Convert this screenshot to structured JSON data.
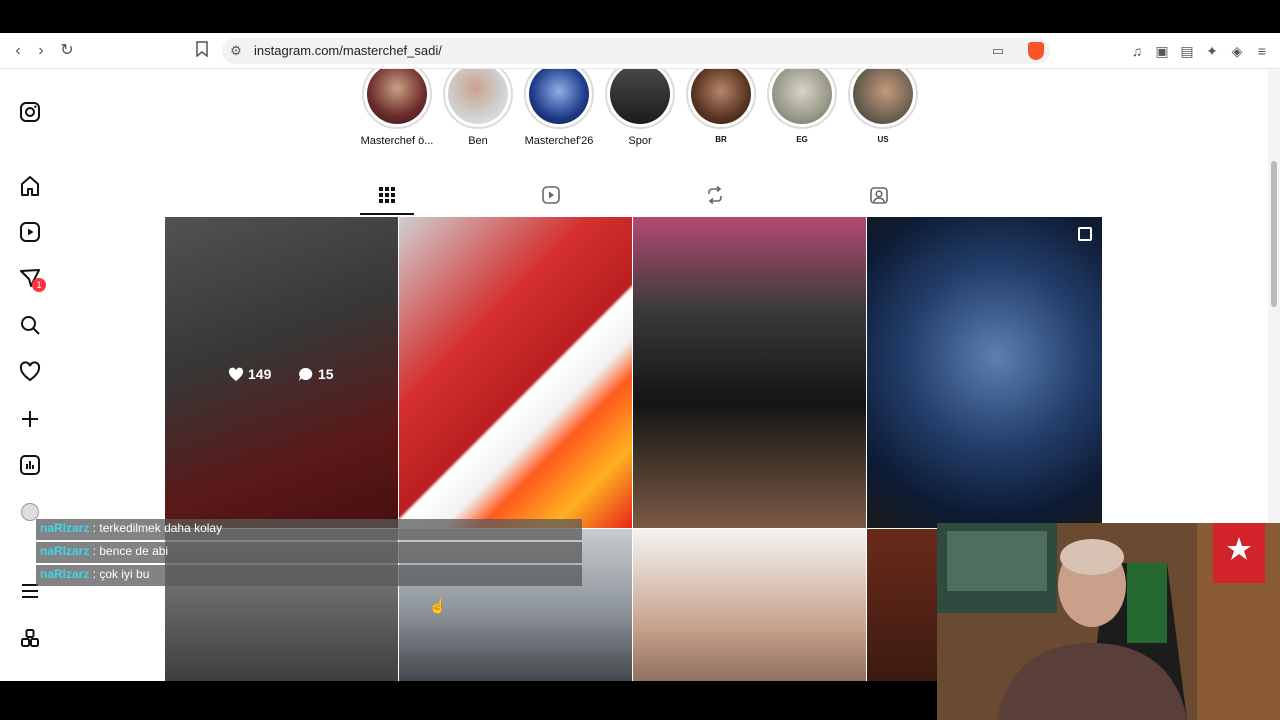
{
  "browser": {
    "url": "instagram.com/masterchef_sadi/"
  },
  "sidebar": {
    "notification_count": "1"
  },
  "highlights": [
    {
      "label": "Masterchef ö...",
      "small": false,
      "color": "#6b2b2b"
    },
    {
      "label": "Ben",
      "small": false,
      "color": "#cfcfcf"
    },
    {
      "label": "Masterchef'26",
      "small": false,
      "color": "#1f3b8a"
    },
    {
      "label": "Spor",
      "small": false,
      "color": "#2a2a2a"
    },
    {
      "label": "BR",
      "small": true,
      "color": "#5a3524"
    },
    {
      "label": "EG",
      "small": true,
      "color": "#9a9a8a"
    },
    {
      "label": "US",
      "small": true,
      "color": "#6a6050"
    }
  ],
  "post_stats": {
    "likes": "149",
    "comments": "15"
  },
  "chat": [
    {
      "user": "naRlzarz",
      "sep": " : ",
      "message": "terkedilmek daha kolay"
    },
    {
      "user": "naRlzarz",
      "sep": " : ",
      "message": "bence de abi"
    },
    {
      "user": "naRlzarz",
      "sep": " : ",
      "message": "çok iyi bu"
    }
  ],
  "colors": {
    "accent_badge": "#ff3040",
    "chat_user": "#3fd5e8",
    "brave": "#fb542b"
  }
}
